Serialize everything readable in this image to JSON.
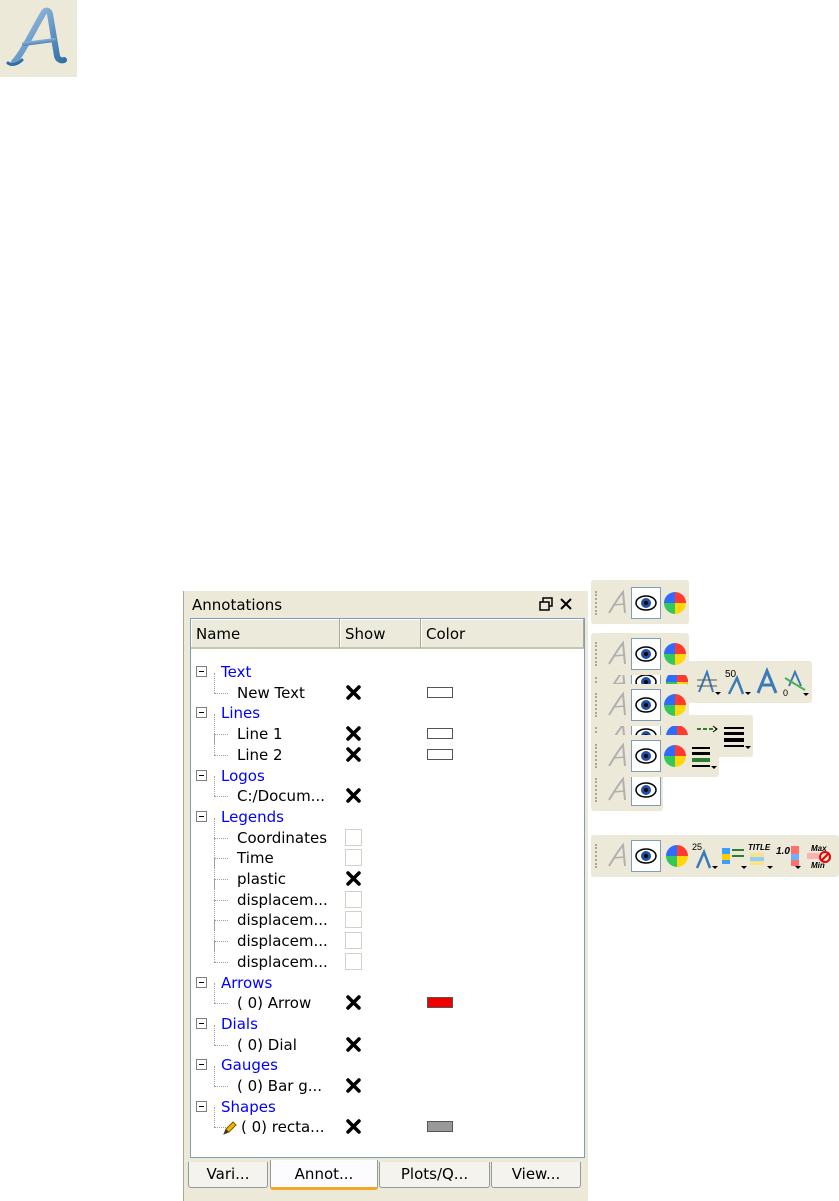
{
  "panel": {
    "title": "Annotations",
    "columns": {
      "name": "Name",
      "show": "Show",
      "color": "Color"
    },
    "rows": [
      {
        "kind": "group",
        "label": "Text"
      },
      {
        "kind": "child",
        "label": "New Text",
        "show": "checked",
        "color": "#ffffff"
      },
      {
        "kind": "group",
        "label": "Lines"
      },
      {
        "kind": "child",
        "label": "Line 1",
        "show": "checked",
        "color": "#ffffff"
      },
      {
        "kind": "child",
        "label": "Line 2",
        "show": "checked",
        "color": "#ffffff"
      },
      {
        "kind": "group",
        "label": "Logos"
      },
      {
        "kind": "child",
        "label": "C:/Docum...",
        "show": "checked"
      },
      {
        "kind": "group",
        "label": "Legends"
      },
      {
        "kind": "child",
        "label": "Coordinates",
        "show": "unchecked"
      },
      {
        "kind": "child",
        "label": "Time",
        "show": "unchecked"
      },
      {
        "kind": "child",
        "label": "plastic",
        "show": "checked"
      },
      {
        "kind": "child",
        "label": "displacem...",
        "show": "unchecked"
      },
      {
        "kind": "child",
        "label": "displacem...",
        "show": "unchecked"
      },
      {
        "kind": "child",
        "label": "displacem...",
        "show": "unchecked"
      },
      {
        "kind": "child",
        "label": "displacem...",
        "show": "unchecked"
      },
      {
        "kind": "group",
        "label": "Arrows"
      },
      {
        "kind": "child",
        "label": "( 0) Arrow",
        "show": "checked",
        "color": "#ee0000"
      },
      {
        "kind": "group",
        "label": "Dials"
      },
      {
        "kind": "child",
        "label": "( 0) Dial",
        "show": "checked"
      },
      {
        "kind": "group",
        "label": "Gauges"
      },
      {
        "kind": "child",
        "label": "( 0) Bar g...",
        "show": "checked"
      },
      {
        "kind": "group",
        "label": "Shapes"
      },
      {
        "kind": "child",
        "label": "( 0) recta...",
        "show": "checked",
        "color": "#999999",
        "icon": "pencil-icon"
      }
    ],
    "tabs": [
      "Vari...",
      "Annot...",
      "Plots/Q...",
      "View..."
    ],
    "active_tab": "Annot..."
  },
  "toolbars": {
    "text": {
      "font_size_label": "50",
      "offset_label": "0"
    },
    "legends": {
      "font_size_label": "25",
      "title_label": "TITLE",
      "number_label": "1.0",
      "max_label": "Max",
      "min_label": "Min"
    }
  },
  "icons": {
    "big": "annotation-text-icon",
    "eye": "eye-icon",
    "color": "color-wheel-icon"
  }
}
